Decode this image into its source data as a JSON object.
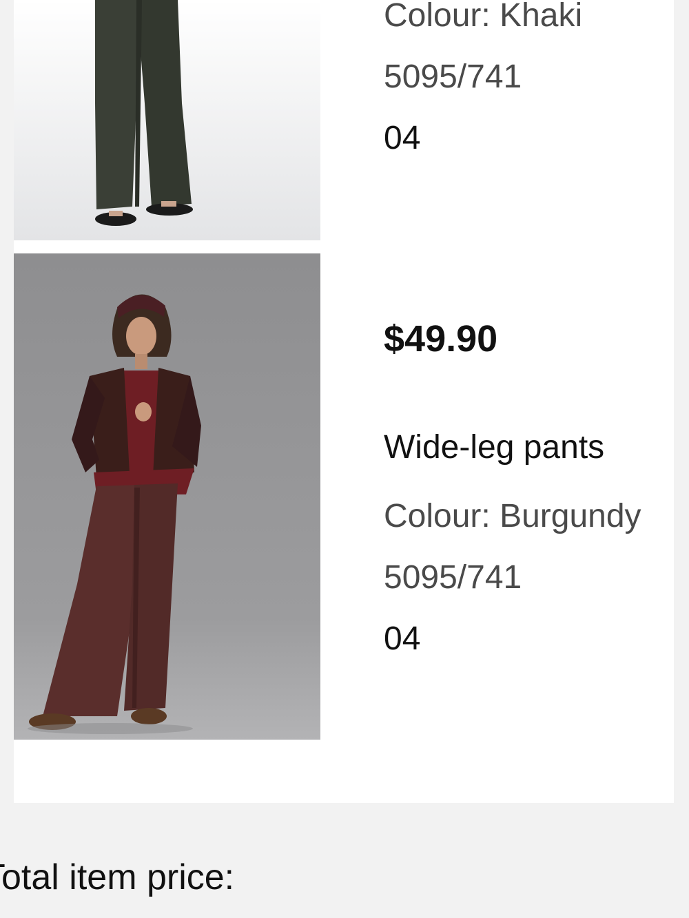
{
  "items": [
    {
      "image": "khaki-wide-leg-pants-photo",
      "colour": "Colour: Khaki",
      "reference": "5095/741",
      "size": "04"
    },
    {
      "image": "burgundy-wide-leg-pants-photo",
      "price": "$49.90",
      "name": "Wide-leg pants",
      "colour": "Colour: Burgundy",
      "reference": "5095/741",
      "size": "04"
    }
  ],
  "summary": {
    "total_label": "Total item price:"
  },
  "colors": {
    "background": "#f2f2f2",
    "card": "#ffffff",
    "khaki_pants": "#3a3f36",
    "burgundy_pants": "#5a2e2c",
    "cardigan": "#3a1e1a",
    "studio_grey": "#8e8e90"
  }
}
